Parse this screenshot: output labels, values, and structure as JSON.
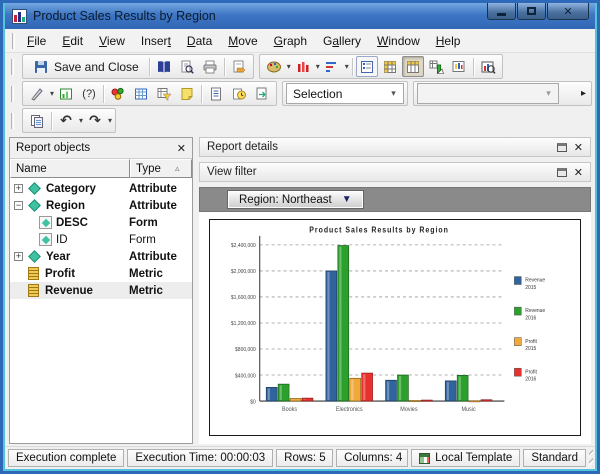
{
  "window": {
    "title": "Product Sales Results by Region"
  },
  "icons": {
    "close": "✕",
    "caret": "▾",
    "dropdown_filled": "▼",
    "sort_asc": "▵",
    "undo": "↶",
    "redo": "↷",
    "overflow": "▸",
    "help": "(?)"
  },
  "menu": {
    "items": [
      {
        "label": "File",
        "underline": 0
      },
      {
        "label": "Edit",
        "underline": 0
      },
      {
        "label": "View",
        "underline": 0
      },
      {
        "label": "Insert",
        "underline": 5
      },
      {
        "label": "Data",
        "underline": 0
      },
      {
        "label": "Move",
        "underline": 0
      },
      {
        "label": "Graph",
        "underline": 0
      },
      {
        "label": "Gallery",
        "underline": 1
      },
      {
        "label": "Window",
        "underline": 0
      },
      {
        "label": "Help",
        "underline": 0
      }
    ]
  },
  "toolbar": {
    "save_and_close": "Save and Close",
    "selection_combo_value": "Selection",
    "secondary_combo_value": ""
  },
  "report_objects": {
    "title": "Report objects",
    "columns": {
      "name": "Name",
      "type": "Type"
    },
    "rows": [
      {
        "name": "Category",
        "type": "Attribute",
        "icon": "attribute",
        "expander": "+",
        "indent": 0,
        "bold": true,
        "type_bold": true,
        "highlighted": false
      },
      {
        "name": "Region",
        "type": "Attribute",
        "icon": "attribute",
        "expander": "-",
        "indent": 0,
        "bold": true,
        "type_bold": true,
        "highlighted": false
      },
      {
        "name": "DESC",
        "type": "Form",
        "icon": "form",
        "expander": "",
        "indent": 1,
        "bold": true,
        "type_bold": true,
        "highlighted": false
      },
      {
        "name": "ID",
        "type": "Form",
        "icon": "form",
        "expander": "",
        "indent": 1,
        "bold": false,
        "type_bold": false,
        "highlighted": false
      },
      {
        "name": "Year",
        "type": "Attribute",
        "icon": "attribute",
        "expander": "+",
        "indent": 0,
        "bold": true,
        "type_bold": true,
        "highlighted": false
      },
      {
        "name": "Profit",
        "type": "Metric",
        "icon": "metric",
        "expander": "",
        "indent": 0,
        "bold": true,
        "type_bold": true,
        "highlighted": false
      },
      {
        "name": "Revenue",
        "type": "Metric",
        "icon": "metric",
        "expander": "",
        "indent": 0,
        "bold": true,
        "type_bold": true,
        "highlighted": true
      }
    ]
  },
  "panels": {
    "report_details_title": "Report details",
    "view_filter_title": "View filter",
    "filter_button_label": "Region: Northeast"
  },
  "chart_data": {
    "type": "bar",
    "title": "Product Sales Results by Region",
    "categories": [
      "Books",
      "Electronics",
      "Movies",
      "Music"
    ],
    "series": [
      {
        "name": "Revenue 2015",
        "color": "#31639C",
        "values": [
          210000,
          2000000,
          320000,
          310000
        ]
      },
      {
        "name": "Revenue 2016",
        "color": "#2CA02C",
        "values": [
          260000,
          2390000,
          400000,
          395000
        ]
      },
      {
        "name": "Profit 2015",
        "color": "#F2A93B",
        "values": [
          40000,
          350000,
          8000,
          5000
        ]
      },
      {
        "name": "Profit 2016",
        "color": "#E8312F",
        "values": [
          45000,
          430000,
          15000,
          20000
        ]
      }
    ],
    "xlabel": "",
    "ylabel": "",
    "ylim": [
      0,
      2400000
    ],
    "ytick_step": 400000,
    "ytick_labels": [
      "$0",
      "$400,000",
      "$800,000",
      "$1,200,000",
      "$1,600,000",
      "$2,000,000",
      "$2,400,000"
    ],
    "grid": "dashed-horizontal",
    "legend_position": "right"
  },
  "status": {
    "execution": "Execution complete",
    "time": "Execution Time: 00:00:03",
    "rows": "Rows: 5",
    "columns": "Columns: 4",
    "template": "Local Template",
    "mode": "Standard"
  }
}
